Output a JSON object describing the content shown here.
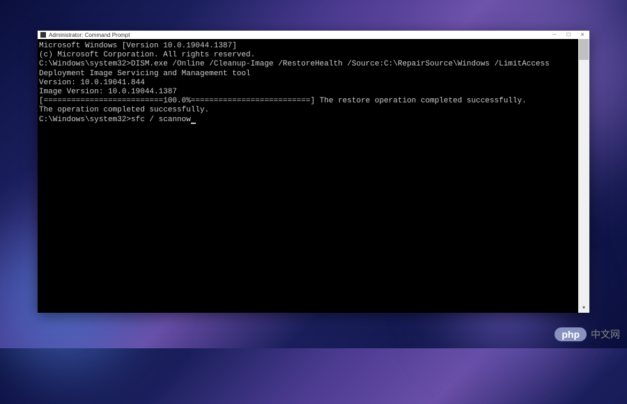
{
  "window": {
    "title": "Administrator: Command Prompt"
  },
  "terminal": {
    "lines": {
      "l1": "Microsoft Windows [Version 10.0.19044.1387]",
      "l2": "(c) Microsoft Corporation. All rights reserved.",
      "l3": "",
      "l4": "C:\\Windows\\system32>DISM.exe /Online /Cleanup-Image /RestoreHealth /Source:C:\\RepairSource\\Windows /LimitAccess",
      "l5": "",
      "l6": "Deployment Image Servicing and Management tool",
      "l7": "Version: 10.0.19041.844",
      "l8": "",
      "l9": "Image Version: 10.0.19044.1387",
      "l10": "",
      "l11": "[==========================100.0%==========================] The restore operation completed successfully.",
      "l12": "The operation completed successfully.",
      "l13": "",
      "prompt": "C:\\Windows\\system32>",
      "current_command": "sfc / scannow"
    }
  },
  "watermark": {
    "badge": "php",
    "text": "中文网"
  }
}
